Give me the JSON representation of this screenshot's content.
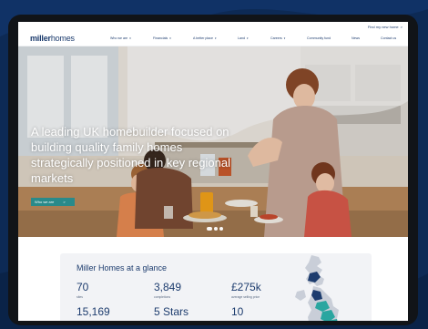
{
  "topbar": {
    "find_home": "Find my new home",
    "find_home_arrow": ">"
  },
  "brand": {
    "bold": "miller",
    "light": "homes"
  },
  "nav": [
    {
      "label": "Who we are",
      "caret": "▾"
    },
    {
      "label": "Financials",
      "caret": "▾"
    },
    {
      "label": "A better place",
      "caret": "▾"
    },
    {
      "label": "Land",
      "caret": "▾"
    },
    {
      "label": "Careers",
      "caret": "▾"
    },
    {
      "label": "Community fund",
      "caret": ""
    },
    {
      "label": "News",
      "caret": ""
    },
    {
      "label": "Contact us",
      "caret": ""
    }
  ],
  "hero": {
    "headline": "A leading UK homebuilder focused on building quality family homes strategically positioned in key regional markets",
    "button_label": "Who we are",
    "button_arrow": ">",
    "carousel_active_index": 0,
    "carousel_count": 3
  },
  "glance": {
    "title": "Miller Homes at a glance",
    "stats": [
      {
        "value": "70",
        "label": "sites"
      },
      {
        "value": "3,849",
        "label": "completions"
      },
      {
        "value": "£275k",
        "label": "average selling price"
      },
      {
        "value": "15,169",
        "label": ""
      },
      {
        "value": "5 Stars",
        "label": ""
      },
      {
        "value": "10",
        "label": ""
      }
    ]
  },
  "colors": {
    "background": "#0d2a55",
    "brand_navy": "#1d3c6e",
    "accent_teal": "#2a8a8a"
  }
}
